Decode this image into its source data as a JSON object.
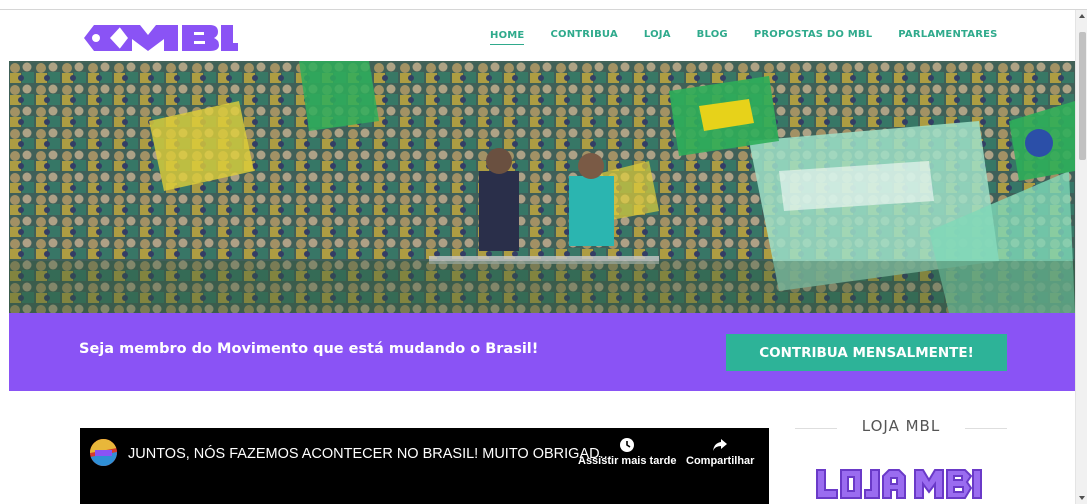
{
  "brand": {
    "logo_text": "MBL",
    "primary_color": "#8a53f5",
    "accent_color": "#2db398"
  },
  "nav": {
    "items": [
      {
        "label": "HOME",
        "active": true
      },
      {
        "label": "CONTRIBUA"
      },
      {
        "label": "LOJA"
      },
      {
        "label": "BLOG"
      },
      {
        "label": "PROPOSTAS DO MBL"
      },
      {
        "label": "PARLAMENTARES"
      }
    ]
  },
  "hero": {
    "image": "crowd-protest-photo"
  },
  "cta": {
    "text": "Seja membro do Movimento que está mudando o Brasil!",
    "button": "CONTRIBUA MENSALMENTE!"
  },
  "video": {
    "title": "JUNTOS, NÓS FAZEMOS ACONTECER NO BRASIL! MUITO OBRIGAD...",
    "watch_later": "Assistir mais tarde",
    "share": "Compartilhar",
    "channel_avatar": "mbl-channel-avatar"
  },
  "sidebar": {
    "title": "LOJA MBL",
    "logo_text": "LOJA MBL"
  }
}
